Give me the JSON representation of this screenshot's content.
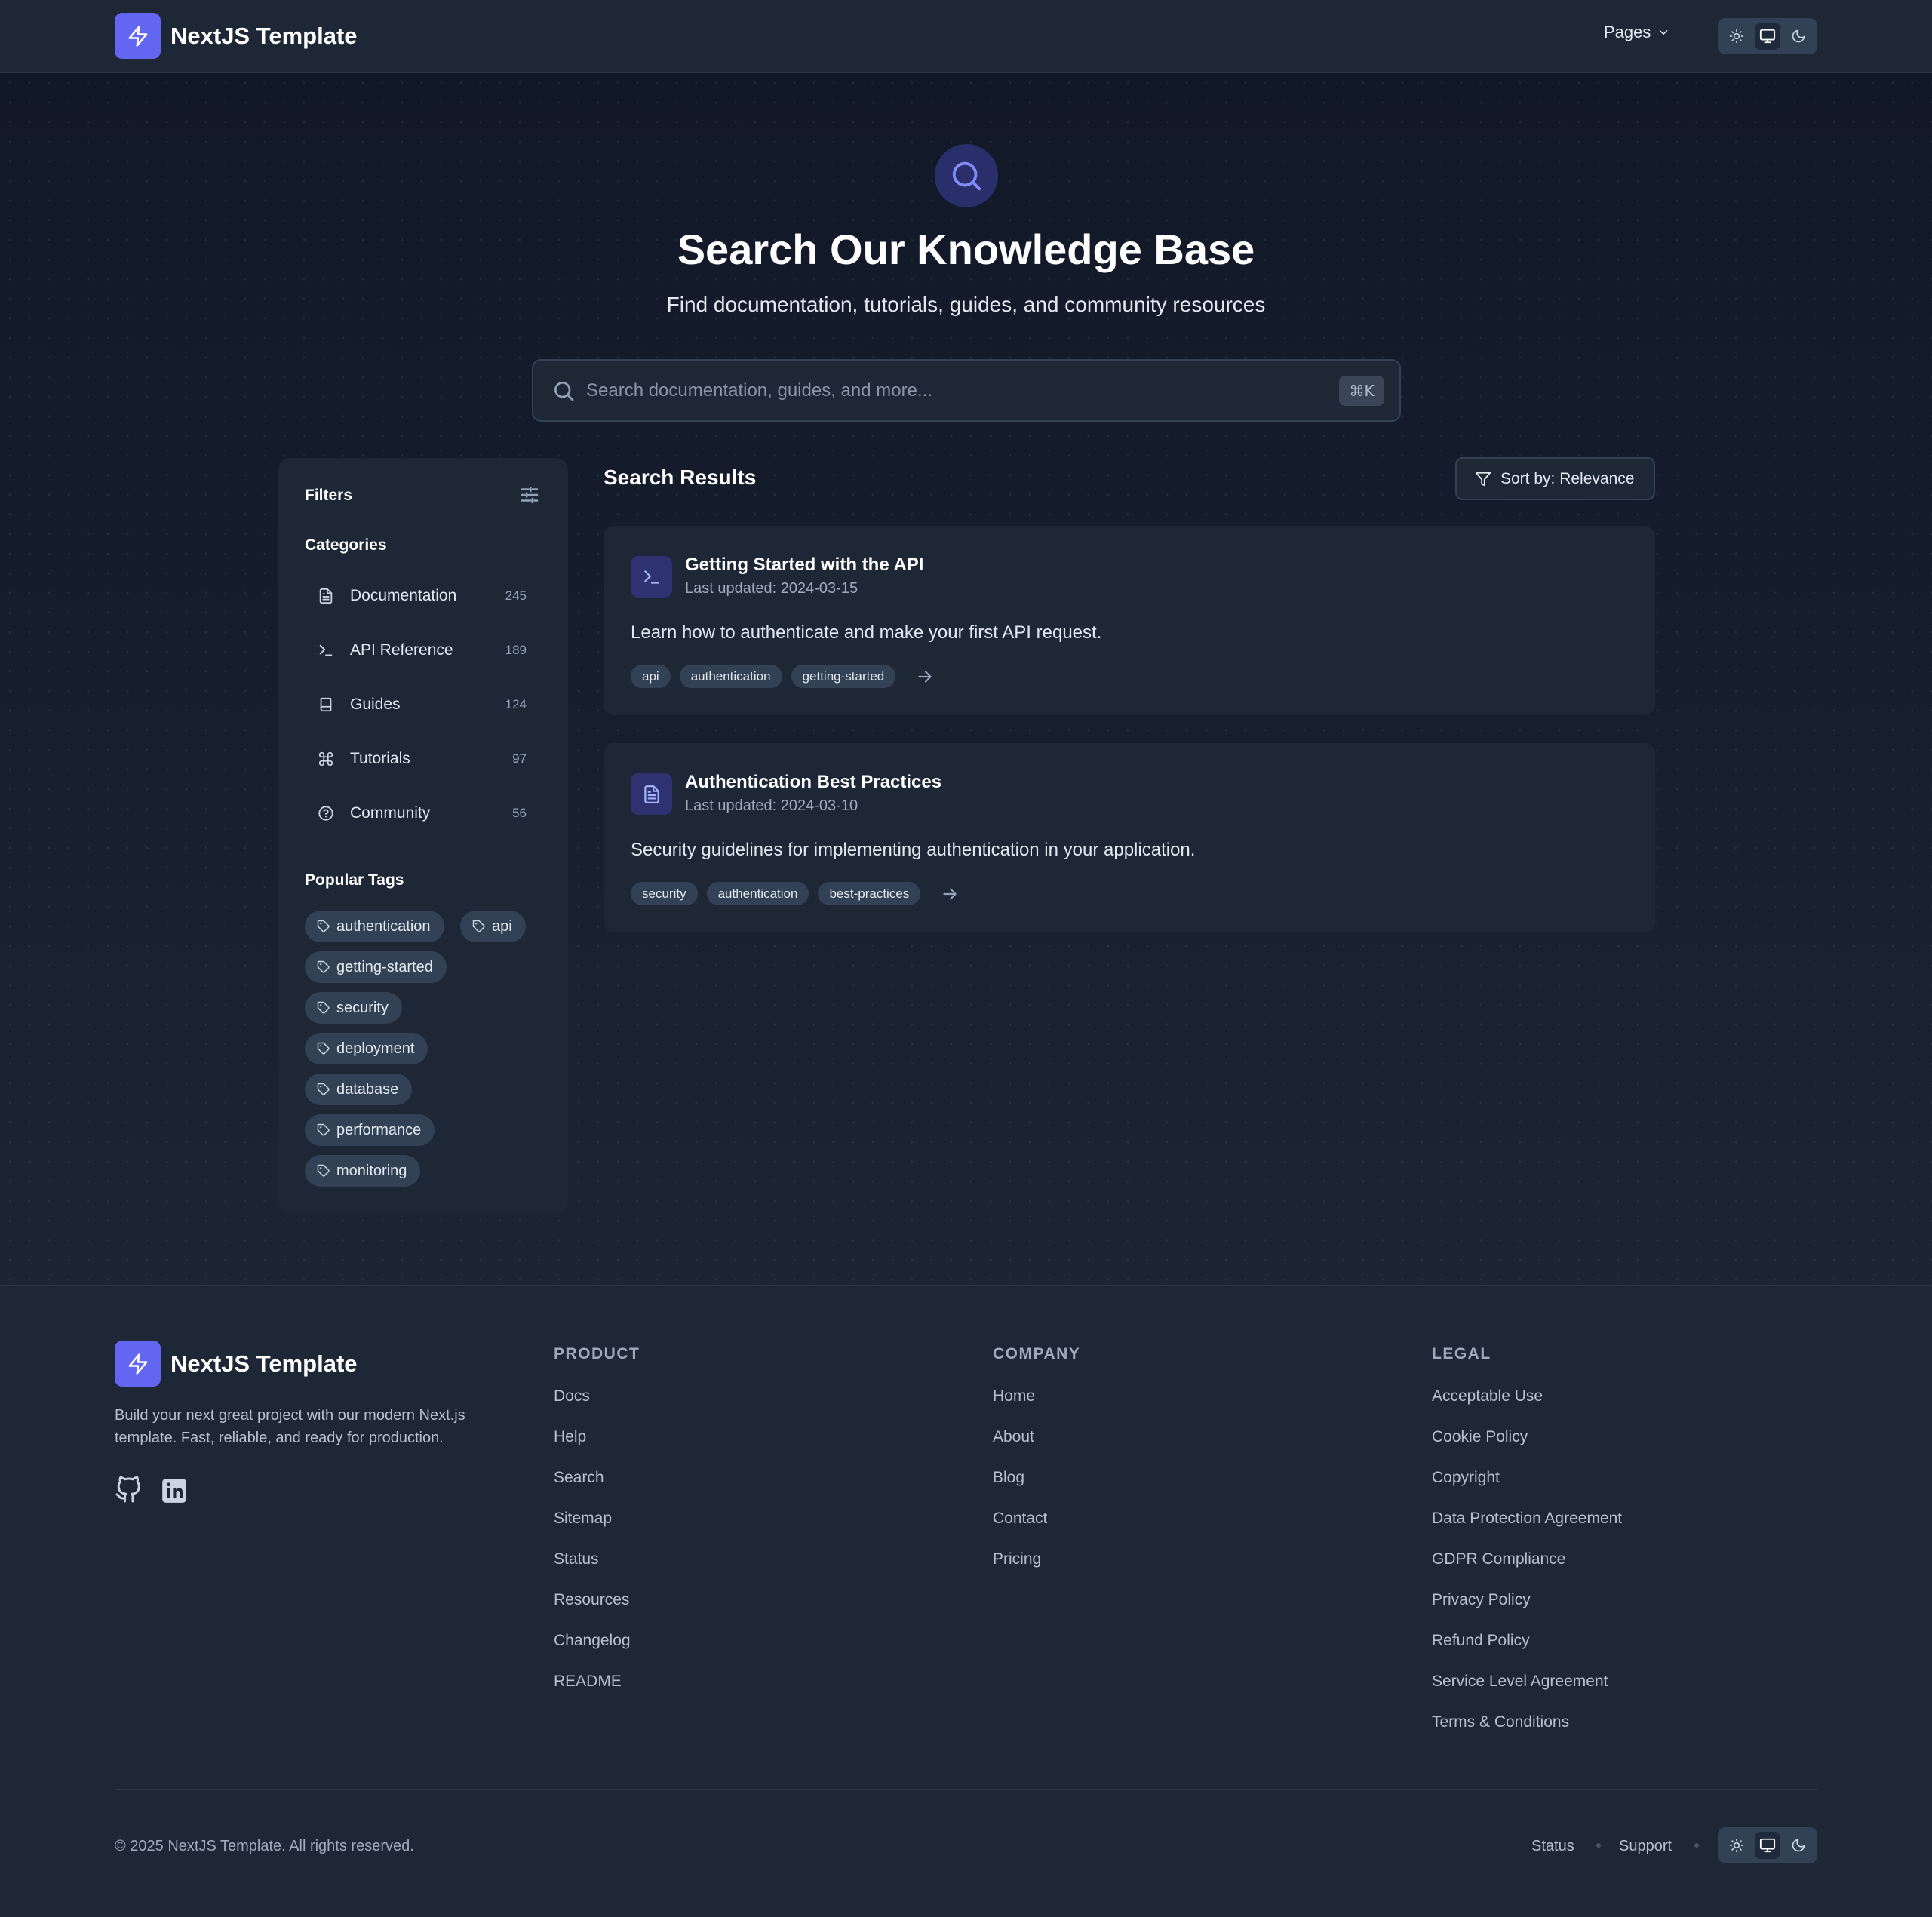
{
  "header": {
    "brand": "NextJS Template",
    "pages_label": "Pages"
  },
  "hero": {
    "title": "Search Our Knowledge Base",
    "subtitle": "Find documentation, tutorials, guides, and community resources",
    "search_placeholder": "Search documentation, guides, and more...",
    "search_value": "",
    "shortcut": "⌘K"
  },
  "filters": {
    "title": "Filters",
    "categories_title": "Categories",
    "categories": [
      {
        "label": "Documentation",
        "count": "245",
        "icon": "file-text-icon"
      },
      {
        "label": "API Reference",
        "count": "189",
        "icon": "terminal-icon"
      },
      {
        "label": "Guides",
        "count": "124",
        "icon": "book-icon"
      },
      {
        "label": "Tutorials",
        "count": "97",
        "icon": "command-icon"
      },
      {
        "label": "Community",
        "count": "56",
        "icon": "help-circle-icon"
      }
    ],
    "tags_title": "Popular Tags",
    "tags": [
      "authentication",
      "api",
      "getting-started",
      "security",
      "deployment",
      "database",
      "performance",
      "monitoring"
    ]
  },
  "results": {
    "title": "Search Results",
    "sort_label": "Sort by: Relevance",
    "items": [
      {
        "title": "Getting Started with the API",
        "date": "Last updated: 2024-03-15",
        "description": "Learn how to authenticate and make your first API request.",
        "tags": [
          "api",
          "authentication",
          "getting-started"
        ],
        "icon": "terminal-icon"
      },
      {
        "title": "Authentication Best Practices",
        "date": "Last updated: 2024-03-10",
        "description": "Security guidelines for implementing authentication in your application.",
        "tags": [
          "security",
          "authentication",
          "best-practices"
        ],
        "icon": "file-text-icon"
      }
    ]
  },
  "footer": {
    "brand": "NextJS Template",
    "description": "Build your next great project with our modern Next.js template. Fast, reliable, and ready for production.",
    "columns": [
      {
        "title": "PRODUCT",
        "links": [
          "Docs",
          "Help",
          "Search",
          "Sitemap",
          "Status",
          "Resources",
          "Changelog",
          "README"
        ]
      },
      {
        "title": "COMPANY",
        "links": [
          "Home",
          "About",
          "Blog",
          "Contact",
          "Pricing"
        ]
      },
      {
        "title": "LEGAL",
        "links": [
          "Acceptable Use",
          "Cookie Policy",
          "Copyright",
          "Data Protection Agreement",
          "GDPR Compliance",
          "Privacy Policy",
          "Refund Policy",
          "Service Level Agreement",
          "Terms & Conditions"
        ]
      }
    ],
    "copyright": "© 2025 NextJS Template. All rights reserved.",
    "bottom_links": [
      "Status",
      "Support"
    ]
  },
  "theme": {
    "accent": "#6366f1",
    "active_mode": "system"
  }
}
